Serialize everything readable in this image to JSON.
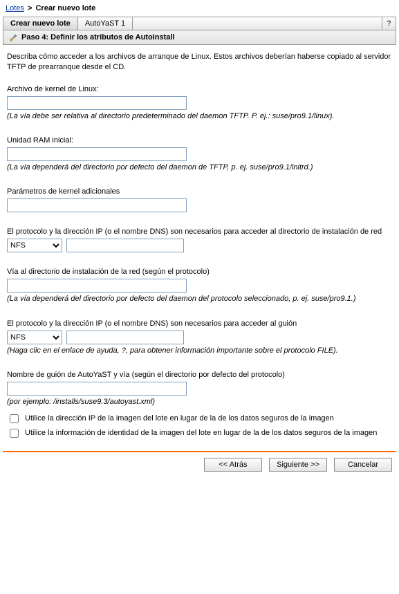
{
  "breadcrumb": {
    "root": "Lotes",
    "sep": ">",
    "current": "Crear nuevo lote"
  },
  "tabs": {
    "t0": "Crear nuevo lote",
    "t1": "AutoYaST 1",
    "help": "?"
  },
  "step": {
    "title": "Paso 4: Definir los atributos de AutoInstall"
  },
  "intro": "Describa cómo acceder a los archivos de arranque de Linux. Estos archivos deberían haberse copiado al servidor TFTP de prearranque desde el CD.",
  "kernel": {
    "label": "Archivo de kernel de Linux:",
    "value": "",
    "hint": "(La vía debe ser relativa al directorio predeterminado del daemon TFTP. P. ej.: suse/pro9.1/linux)."
  },
  "ram": {
    "label": "Unidad RAM inicial:",
    "value": "",
    "hint": "(La vía dependerá del directorio por defecto del daemon de TFTP, p. ej. suse/pro9.1/initrd.)"
  },
  "params": {
    "label": "Parámetros de kernel adicionales",
    "value": ""
  },
  "netinst": {
    "label": "El protocolo y la dirección IP (o el nombre DNS) son necesarios para acceder al directorio de instalación de red",
    "protocol": "NFS",
    "address": ""
  },
  "netpath": {
    "label": "Vía al directorio de instalación de la red (según el protocolo)",
    "value": "",
    "hint": "(La vía dependerá del directorio por defecto del daemon del protocolo seleccionado, p. ej. suse/pro9.1.)"
  },
  "script": {
    "label": "El protocolo y la dirección IP (o el nombre DNS) son necesarios para acceder al guión",
    "protocol": "NFS",
    "address": "",
    "hint": "(Haga clic en el enlace de ayuda, ?, para obtener información importante sobre el protocolo FILE)."
  },
  "scriptname": {
    "label": "Nombre de guión de AutoYaST y vía (según el directorio por defecto del protocolo)",
    "value": "",
    "hint": "(por ejemplo: /installs/suse9.3/autoyast.xml)"
  },
  "checkboxes": {
    "ip": "Utilice la dirección IP de la imagen del lote en lugar de la de los datos seguros de la imagen",
    "identity": "Utilice la información de identidad de la imagen del lote en lugar de la de los datos seguros de la imagen"
  },
  "buttons": {
    "back": "<< Atrás",
    "next": "Siguiente >>",
    "cancel": "Cancelar"
  }
}
